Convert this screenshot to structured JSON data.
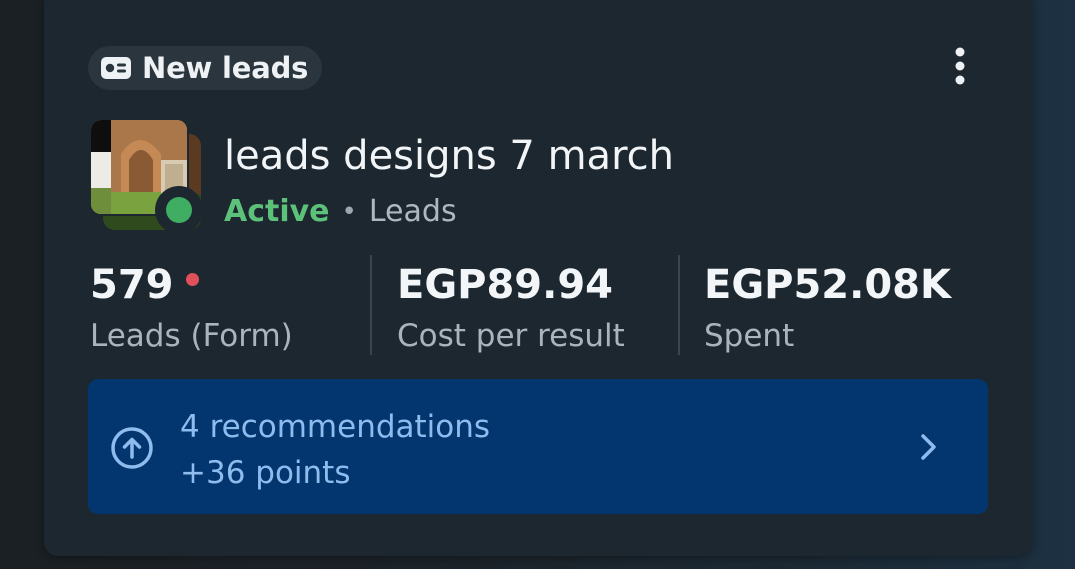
{
  "card": {
    "objective_chip": {
      "icon": "id-card-icon",
      "label": "New leads"
    },
    "more_menu_icon": "more-vertical-icon"
  },
  "campaign": {
    "title": "leads designs 7 march",
    "status": "Active",
    "status_color": "#5cc27a",
    "separator": "•",
    "result_type": "Leads"
  },
  "metrics": [
    {
      "value": "579",
      "label": "Leads (Form)",
      "has_alert_dot": true
    },
    {
      "value": "EGP89.94",
      "label": "Cost per result"
    },
    {
      "value": "EGP52.08K",
      "label": "Spent"
    }
  ],
  "recommendations": {
    "icon": "arrow-up-circle-icon",
    "title": "4 recommendations",
    "subtitle": "+36 points",
    "chevron_icon": "chevron-right-icon",
    "background_color": "#03366f",
    "text_color": "#8fbcef"
  }
}
